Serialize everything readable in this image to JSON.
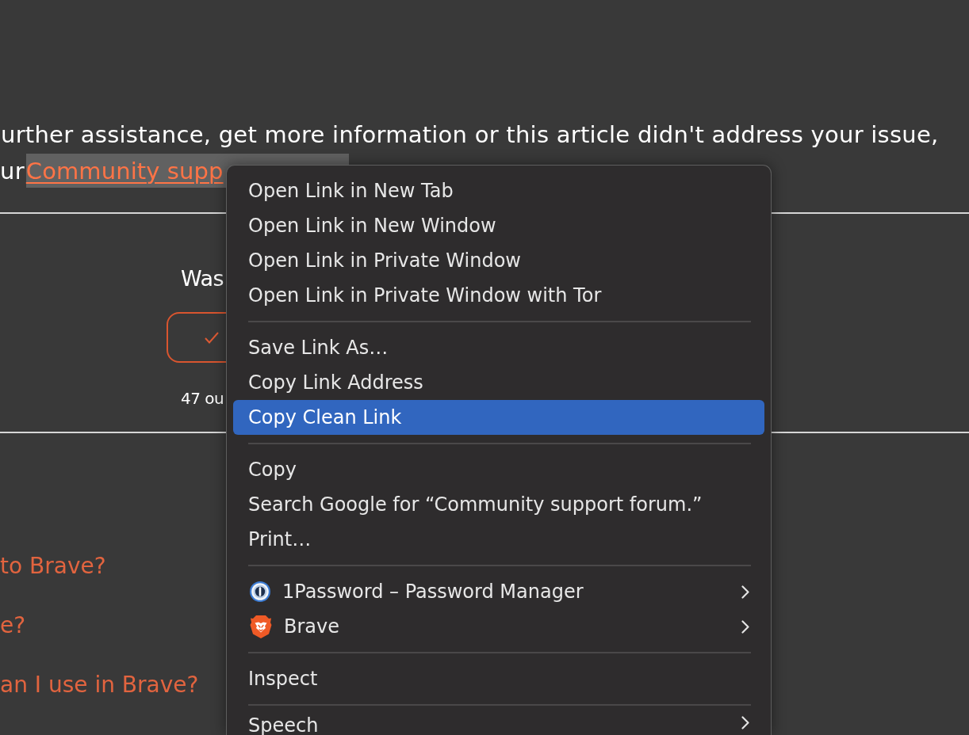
{
  "paragraph": {
    "line_1": "urther assistance, get more information or this article didn't address your issue,",
    "line_2": "ur",
    "link": {
      "label": "Community supp",
      "text_selected": true
    }
  },
  "feedback": {
    "question": "Was",
    "count": "47 ou"
  },
  "related_links": [
    "to Brave?",
    "e?",
    "an I use in Brave?"
  ],
  "context_menu": {
    "groups": [
      [
        {
          "label": "Open Link in New Tab",
          "kind": "action",
          "selected": false
        },
        {
          "label": "Open Link in New Window",
          "kind": "action",
          "selected": false
        },
        {
          "label": "Open Link in Private Window",
          "kind": "action",
          "selected": false
        },
        {
          "label": "Open Link in Private Window with Tor",
          "kind": "action",
          "selected": false
        }
      ],
      [
        {
          "label": "Save Link As…",
          "kind": "action",
          "selected": false
        },
        {
          "label": "Copy Link Address",
          "kind": "action",
          "selected": false
        },
        {
          "label": "Copy Clean Link",
          "kind": "action",
          "selected": true
        }
      ],
      [
        {
          "label": "Copy",
          "kind": "action",
          "selected": false
        },
        {
          "label": "Search Google for “Community support forum.”",
          "kind": "action",
          "selected": false
        },
        {
          "label": "Print…",
          "kind": "action",
          "selected": false
        }
      ],
      [
        {
          "label": "1Password – Password Manager",
          "kind": "extension",
          "selected": false
        },
        {
          "label": "Brave",
          "kind": "extension",
          "selected": false
        }
      ],
      [
        {
          "label": "Inspect",
          "kind": "action",
          "selected": false
        }
      ],
      [
        {
          "label": "Speech",
          "kind": "submenu",
          "selected": false
        }
      ]
    ]
  }
}
